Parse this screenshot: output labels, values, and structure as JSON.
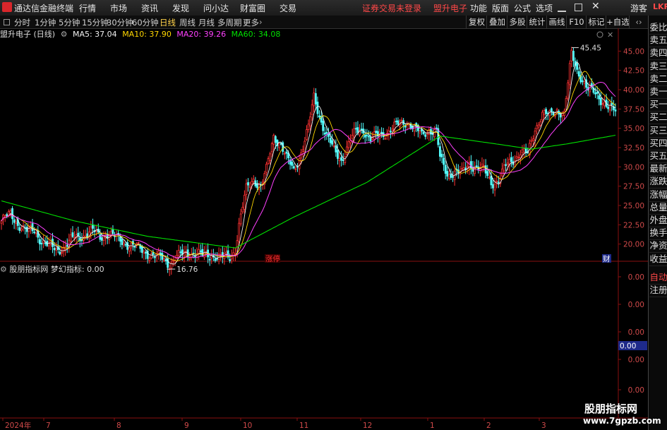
{
  "app": {
    "title": "通达信金融终端",
    "menu": [
      "行情",
      "市场",
      "资讯",
      "发现",
      "问小达",
      "财富圈",
      "交易"
    ],
    "alert": "证券交易未登录",
    "stock_name": "盟升电子",
    "right_menu": [
      "功能",
      "版面",
      "公式",
      "选项"
    ],
    "user": "游客",
    "corner": "LKR"
  },
  "toolbar": {
    "periods": [
      "分时",
      "1分钟",
      "5分钟",
      "15分钟",
      "30分钟",
      "60分钟",
      "日线",
      "周线",
      "月线",
      "多周期",
      "更多"
    ],
    "selected": "日线",
    "right_buttons": [
      "复权",
      "叠加",
      "多股",
      "统计",
      "画线",
      "F10",
      "标记",
      "+自选"
    ]
  },
  "side_panel": {
    "items": [
      "委比",
      "卖五",
      "卖四",
      "卖三",
      "卖二",
      "卖一",
      "买一",
      "买二",
      "买三",
      "买四",
      "买五",
      "最新",
      "涨跌",
      "涨幅",
      "总量",
      "外盘",
      "换手",
      "净资",
      "收益"
    ],
    "ind_items": [
      "自动",
      "注册"
    ]
  },
  "main_chart": {
    "stock_label": "盟升电子 (日线)",
    "ma": [
      {
        "label": "MA5: 37.04",
        "color": "#f0f0f0"
      },
      {
        "label": "MA10: 37.90",
        "color": "#ffd700"
      },
      {
        "label": "MA20: 39.26",
        "color": "#ff40ff"
      },
      {
        "label": "MA60: 34.08",
        "color": "#00e000"
      }
    ],
    "high_label": "45.45",
    "low_label": "16.76",
    "zt_tag": "涨停",
    "cai_tag": "财"
  },
  "indicator": {
    "name": "股朋指标网",
    "label": "梦幻指标: 0.00",
    "ticks": [
      "0.00",
      "0.00",
      "0.00",
      "0.00",
      "0.00"
    ],
    "highlight": "0.00"
  },
  "watermark": {
    "title": "股朋指标网",
    "url": "www.7gpzb.com"
  },
  "chart_data": {
    "type": "candlestick",
    "ylim": [
      17.5,
      46.5
    ],
    "y_ticks": [
      "45.00",
      "42.50",
      "40.00",
      "37.50",
      "35.00",
      "32.50",
      "30.00",
      "27.50",
      "25.00",
      "22.50",
      "20.00"
    ],
    "x_labels": [
      "2024年",
      "7",
      "8",
      "9",
      "10",
      "11",
      "12",
      "1",
      "2",
      "3"
    ],
    "anchors": [
      [
        0,
        23.0
      ],
      [
        5,
        23.8
      ],
      [
        10,
        22.5
      ],
      [
        14,
        21.5
      ],
      [
        18,
        21.8
      ],
      [
        22,
        20.5
      ],
      [
        26,
        19.6
      ],
      [
        30,
        19.3
      ],
      [
        35,
        19.7
      ],
      [
        40,
        20.8
      ],
      [
        45,
        21.2
      ],
      [
        50,
        21.6
      ],
      [
        54,
        21.0
      ],
      [
        58,
        21.4
      ],
      [
        62,
        20.8
      ],
      [
        67,
        20.3
      ],
      [
        72,
        19.7
      ],
      [
        76,
        19.3
      ],
      [
        80,
        18.9
      ],
      [
        84,
        18.4
      ],
      [
        88,
        18.1
      ],
      [
        92,
        17.5
      ],
      [
        95,
        18.2
      ],
      [
        100,
        18.7
      ],
      [
        105,
        19.0
      ],
      [
        110,
        18.4
      ],
      [
        115,
        18.7
      ],
      [
        120,
        18.2
      ],
      [
        125,
        18.3
      ],
      [
        128,
        19.5
      ],
      [
        130,
        22.5
      ],
      [
        134,
        27.0
      ],
      [
        138,
        28.5
      ],
      [
        142,
        27.5
      ],
      [
        145,
        29.5
      ],
      [
        149,
        34.0
      ],
      [
        153,
        33.0
      ],
      [
        156,
        31.0
      ],
      [
        160,
        29.5
      ],
      [
        164,
        32.0
      ],
      [
        168,
        35.0
      ],
      [
        171,
        39.0
      ],
      [
        175,
        36.0
      ],
      [
        178,
        34.0
      ],
      [
        182,
        32.0
      ],
      [
        186,
        31.0
      ],
      [
        190,
        33.0
      ],
      [
        194,
        34.5
      ],
      [
        198,
        35.0
      ],
      [
        202,
        33.5
      ],
      [
        206,
        34.0
      ],
      [
        210,
        34.5
      ],
      [
        214,
        35.0
      ],
      [
        218,
        35.5
      ],
      [
        222,
        36.0
      ],
      [
        226,
        35.0
      ],
      [
        230,
        34.0
      ],
      [
        234,
        35.0
      ],
      [
        238,
        34.5
      ],
      [
        240,
        31.0
      ],
      [
        244,
        29.0
      ],
      [
        248,
        29.5
      ],
      [
        252,
        29.0
      ],
      [
        256,
        30.5
      ],
      [
        260,
        30.0
      ],
      [
        264,
        29.5
      ],
      [
        268,
        28.0
      ],
      [
        272,
        28.3
      ],
      [
        276,
        30.0
      ],
      [
        280,
        31.0
      ],
      [
        284,
        32.0
      ],
      [
        288,
        31.5
      ],
      [
        292,
        35.0
      ],
      [
        296,
        37.0
      ],
      [
        300,
        36.5
      ],
      [
        304,
        37.5
      ],
      [
        308,
        37.0
      ],
      [
        312,
        44.5
      ],
      [
        315,
        42.5
      ],
      [
        318,
        41.5
      ],
      [
        321,
        40.0
      ],
      [
        324,
        39.5
      ],
      [
        327,
        39.0
      ],
      [
        330,
        38.5
      ],
      [
        333,
        37.5
      ],
      [
        336,
        37.0
      ]
    ],
    "series": [
      {
        "name": "MA5",
        "color": "#f0f0f0",
        "last": 37.04
      },
      {
        "name": "MA10",
        "color": "#ffd700",
        "last": 37.9
      },
      {
        "name": "MA20",
        "color": "#ff40ff",
        "last": 39.26
      },
      {
        "name": "MA60",
        "color": "#00e000",
        "last": 34.08
      }
    ],
    "ma60_anchors": [
      [
        0,
        25.6
      ],
      [
        40,
        23.0
      ],
      [
        80,
        21.0
      ],
      [
        128,
        19.5
      ],
      [
        160,
        23.5
      ],
      [
        200,
        28.0
      ],
      [
        240,
        34.0
      ],
      [
        270,
        33.0
      ],
      [
        290,
        32.3
      ],
      [
        310,
        33.0
      ],
      [
        336,
        34.1
      ]
    ],
    "high": 45.45,
    "low": 16.76
  }
}
